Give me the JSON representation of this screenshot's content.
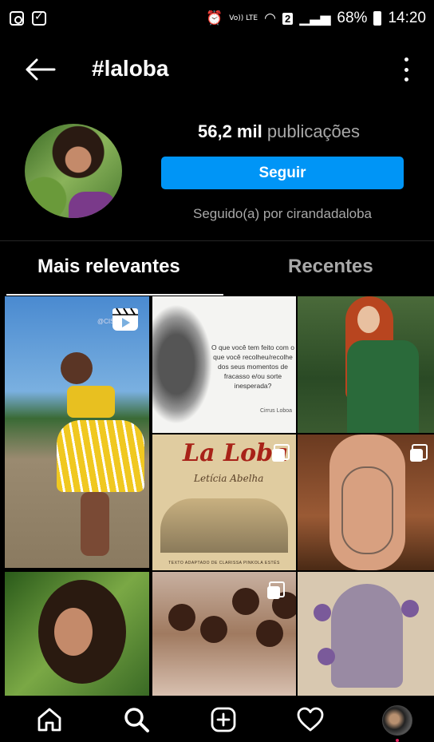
{
  "status_bar": {
    "volte": "Vo)) LTE",
    "sim": "2",
    "battery": "68%",
    "time": "14:20"
  },
  "header": {
    "back_icon": "arrow-left-icon",
    "title": "#laloba",
    "more_icon": "more-vertical-icon"
  },
  "profile": {
    "posts_count": "56,2 mil",
    "posts_label": "publicações",
    "follow_label": "Seguir",
    "followed_by": "Seguido(a) por cirandadaloba"
  },
  "tabs": [
    {
      "label": "Mais relevantes",
      "active": true
    },
    {
      "label": "Recentes",
      "active": false
    }
  ],
  "grid": {
    "posts": [
      {
        "watermark": "@CISC...ATA",
        "type": "reel"
      },
      {
        "caption": "O que você tem feito com o que você recolheu/recolhe dos seus momentos de fracasso e/ou sorte inesperada?",
        "signature": "Cirrus Loboa",
        "type": "image"
      },
      {
        "type": "image"
      },
      {
        "title": "La Loba",
        "subtitle": "Letícia Abelha",
        "credit": "TEXTO ADAPTADO DE CLARISSA PINKOLA ESTÉS",
        "type": "carousel"
      },
      {
        "type": "carousel"
      },
      {
        "type": "image"
      },
      {
        "type": "carousel"
      },
      {
        "type": "image"
      }
    ]
  },
  "bottom_nav": [
    {
      "icon": "home-icon"
    },
    {
      "icon": "search-icon"
    },
    {
      "icon": "add-post-icon"
    },
    {
      "icon": "heart-icon"
    },
    {
      "icon": "profile-avatar"
    }
  ],
  "colors": {
    "accent": "#0095f6",
    "background": "#000000",
    "secondary_text": "#a8a8a8"
  }
}
